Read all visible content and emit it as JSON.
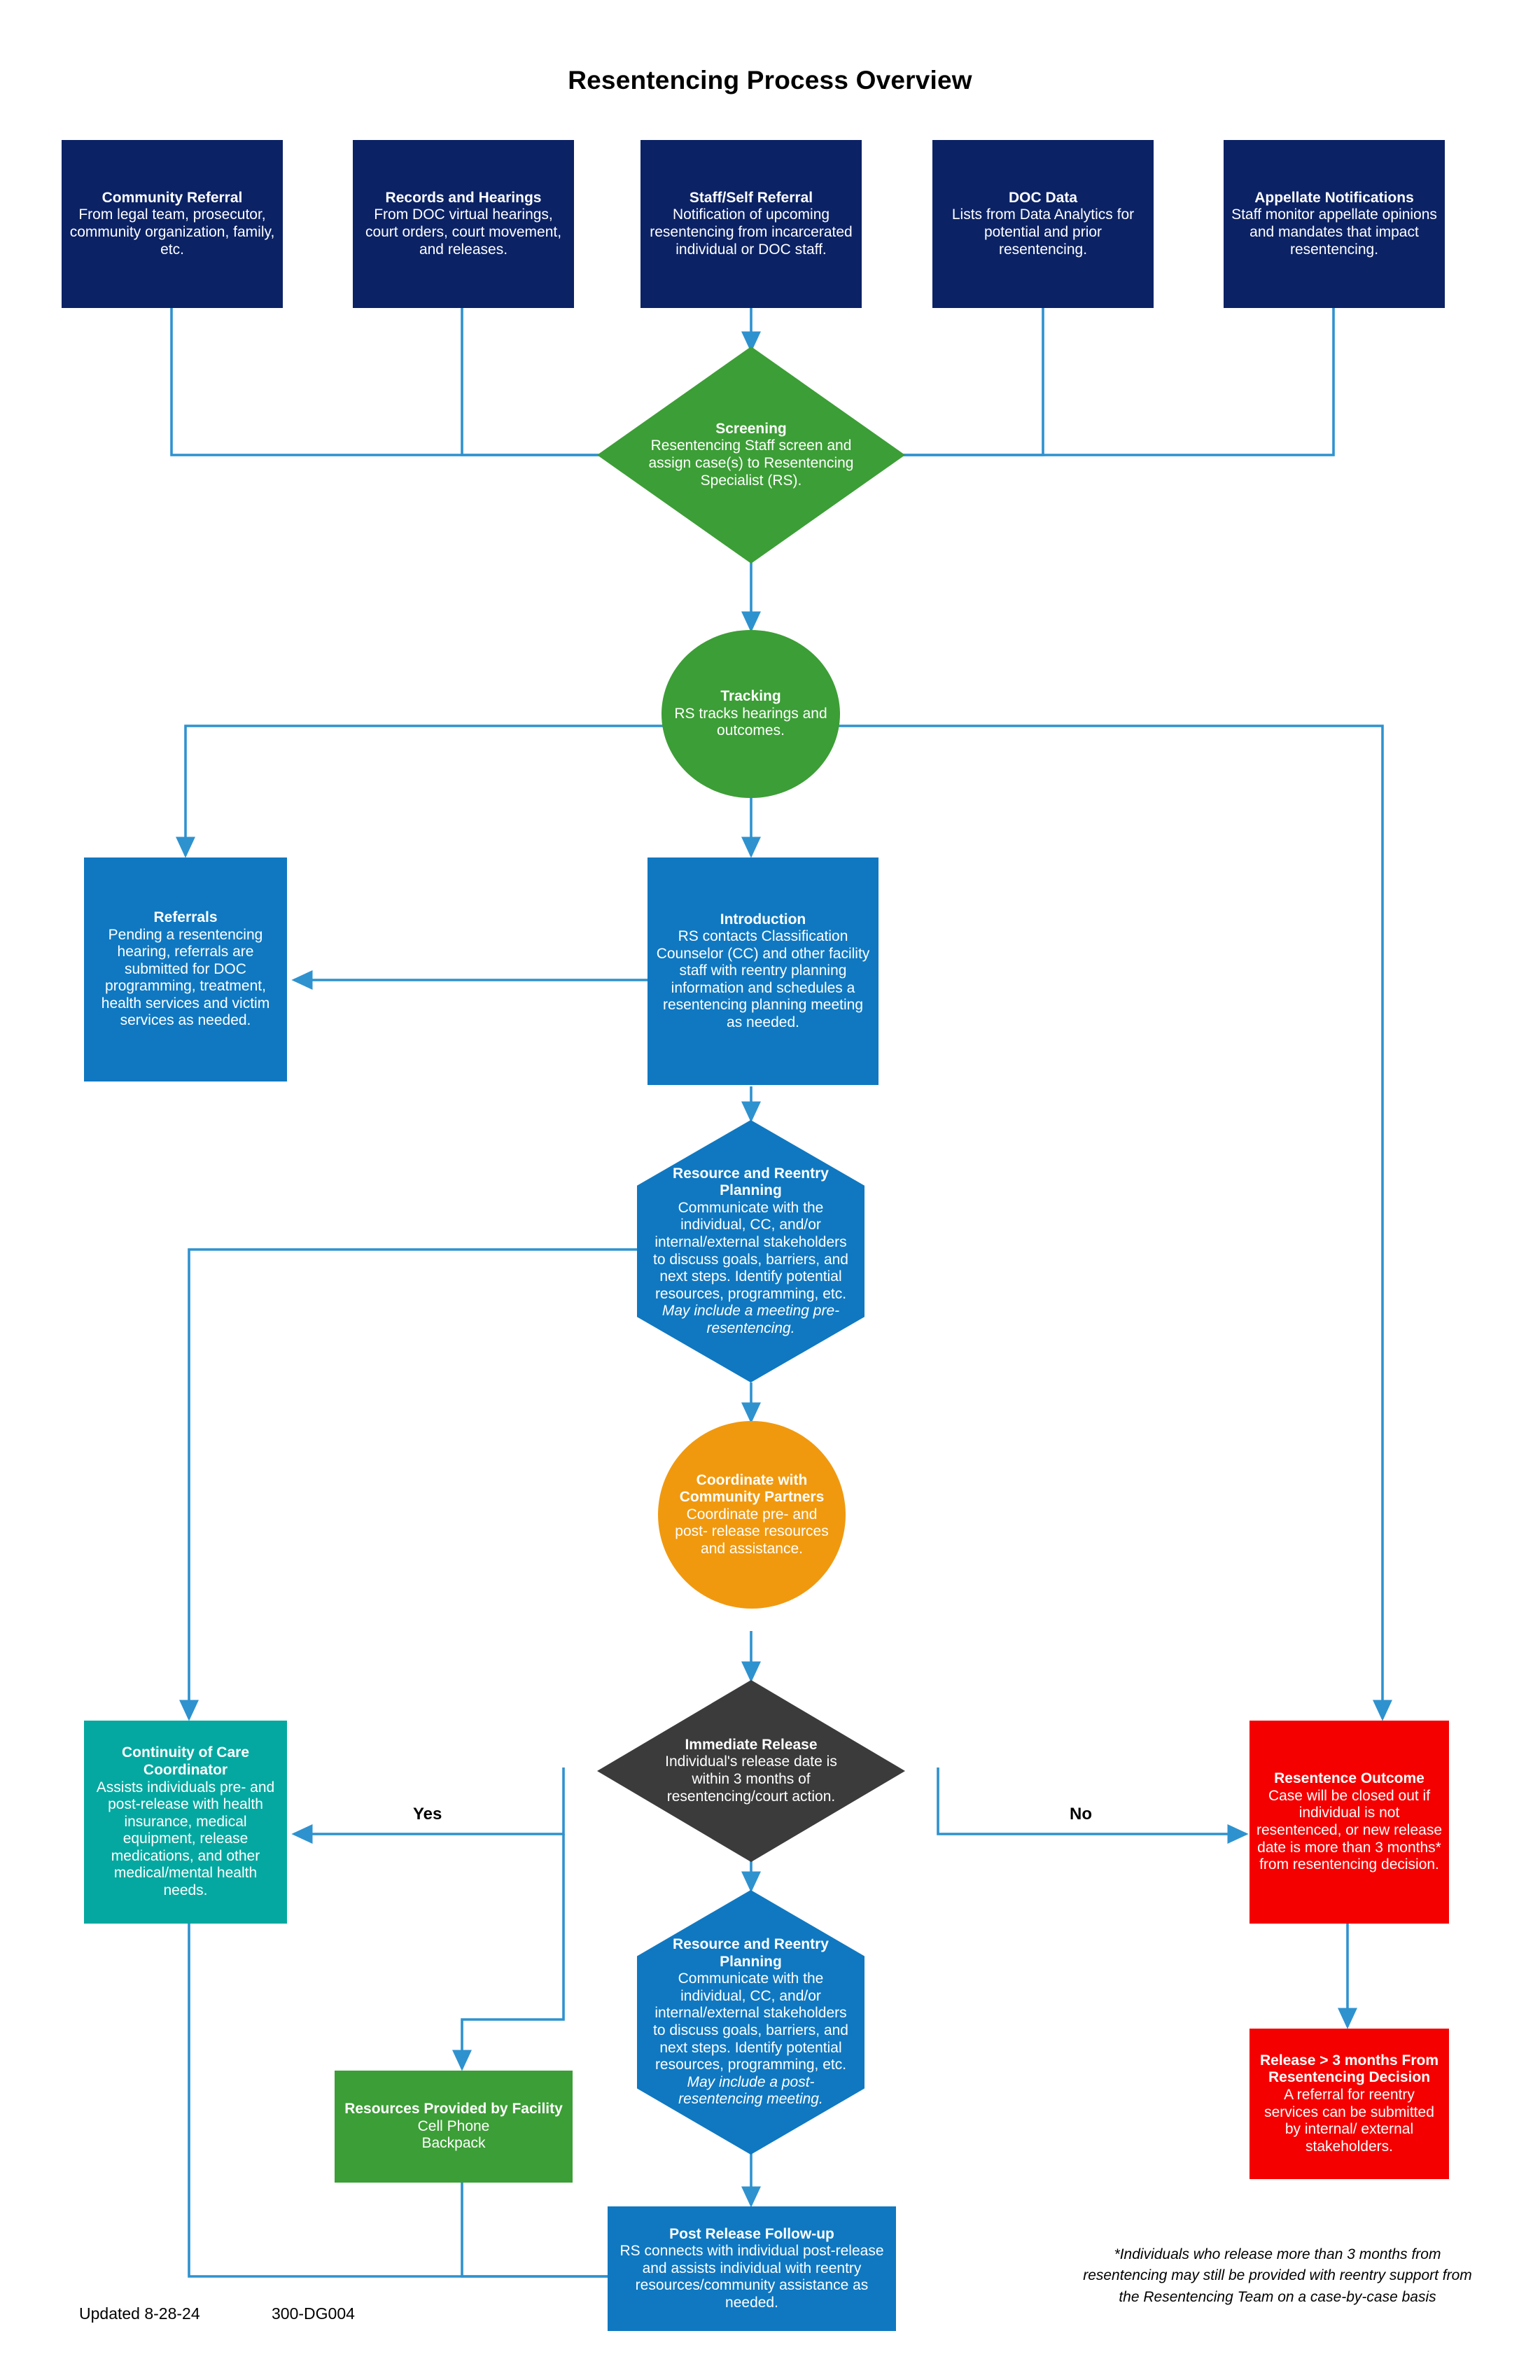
{
  "title": "Resentencing Process Overview",
  "colors": {
    "navy": "#0b2265",
    "blue": "#0f78c1",
    "green": "#3c9e36",
    "teal": "#05a8a0",
    "orange": "#f0990f",
    "red": "#f40000",
    "dark_gray": "#3b3b3b",
    "connector": "#2e92cf"
  },
  "inputs": [
    {
      "title": "Community Referral",
      "body": "From legal team, prosecutor, community organization, family, etc."
    },
    {
      "title": "Records and Hearings",
      "body": "From DOC virtual hearings, court orders, court movement, and releases."
    },
    {
      "title": "Staff/Self Referral",
      "body": "Notification of upcoming resentencing from incarcerated individual or DOC staff."
    },
    {
      "title": "DOC Data",
      "body": "Lists from Data Analytics for potential and prior resentencing."
    },
    {
      "title": "Appellate Notifications",
      "body": "Staff monitor appellate opinions and mandates that impact resentencing."
    }
  ],
  "screening": {
    "title": "Screening",
    "body": "Resentencing Staff screen and assign case(s) to Resentencing Specialist (RS)."
  },
  "tracking": {
    "title": "Tracking",
    "body": "RS tracks hearings and outcomes."
  },
  "referrals": {
    "title": "Referrals",
    "body": "Pending a resentencing hearing, referrals are submitted for DOC programming, treatment, health services and victim services as needed."
  },
  "introduction": {
    "title": "Introduction",
    "body": "RS contacts Classification Counselor (CC) and other facility staff with reentry planning information and schedules a resentencing planning meeting as needed."
  },
  "planning_pre": {
    "title": "Resource and Reentry Planning",
    "body": "Communicate with the individual, CC, and/or internal/external stakeholders to discuss goals, barriers, and next steps. Identify potential resources, programming, etc. ",
    "body_italic": "May include a meeting pre-resentencing."
  },
  "coordinate": {
    "title": "Coordinate with Community Partners",
    "body": "Coordinate pre- and post- release resources and assistance."
  },
  "decision": {
    "title": "Immediate Release",
    "body": "Individual's release date is within 3 months of resentencing/court action."
  },
  "branch_labels": {
    "yes": "Yes",
    "no": "No"
  },
  "continuity": {
    "title": "Continuity of Care Coordinator",
    "body": "Assists individuals pre- and post-release with health insurance, medical equipment, release medications, and other medical/mental health needs."
  },
  "resentence_outcome": {
    "title": "Resentence Outcome",
    "body": "Case will be closed out if individual is not resentenced, or new release date is more than 3 months* from resentencing decision."
  },
  "release_over_3": {
    "title": "Release > 3 months From Resentencing Decision",
    "body": "A referral for reentry services can be submitted by internal/ external stakeholders."
  },
  "facility_resources": {
    "title": "Resources Provided by Facility",
    "body_line1": "Cell Phone",
    "body_line2": "Backpack"
  },
  "planning_post": {
    "title": "Resource and Reentry Planning",
    "body": "Communicate with the individual, CC, and/or internal/external stakeholders to discuss goals, barriers, and next steps. Identify potential resources, programming, etc. ",
    "body_italic": "May include a post-resentencing meeting."
  },
  "post_release": {
    "title": "Post Release Follow-up",
    "body": "RS connects with individual post-release and assists individual with reentry resources/community assistance as needed."
  },
  "footnote": "*Individuals who release more than 3 months from resentencing may still be provided with reentry support from the Resentencing Team on a case-by-case basis",
  "meta": {
    "updated": "Updated 8-28-24",
    "doc_id": "300-DG004"
  }
}
